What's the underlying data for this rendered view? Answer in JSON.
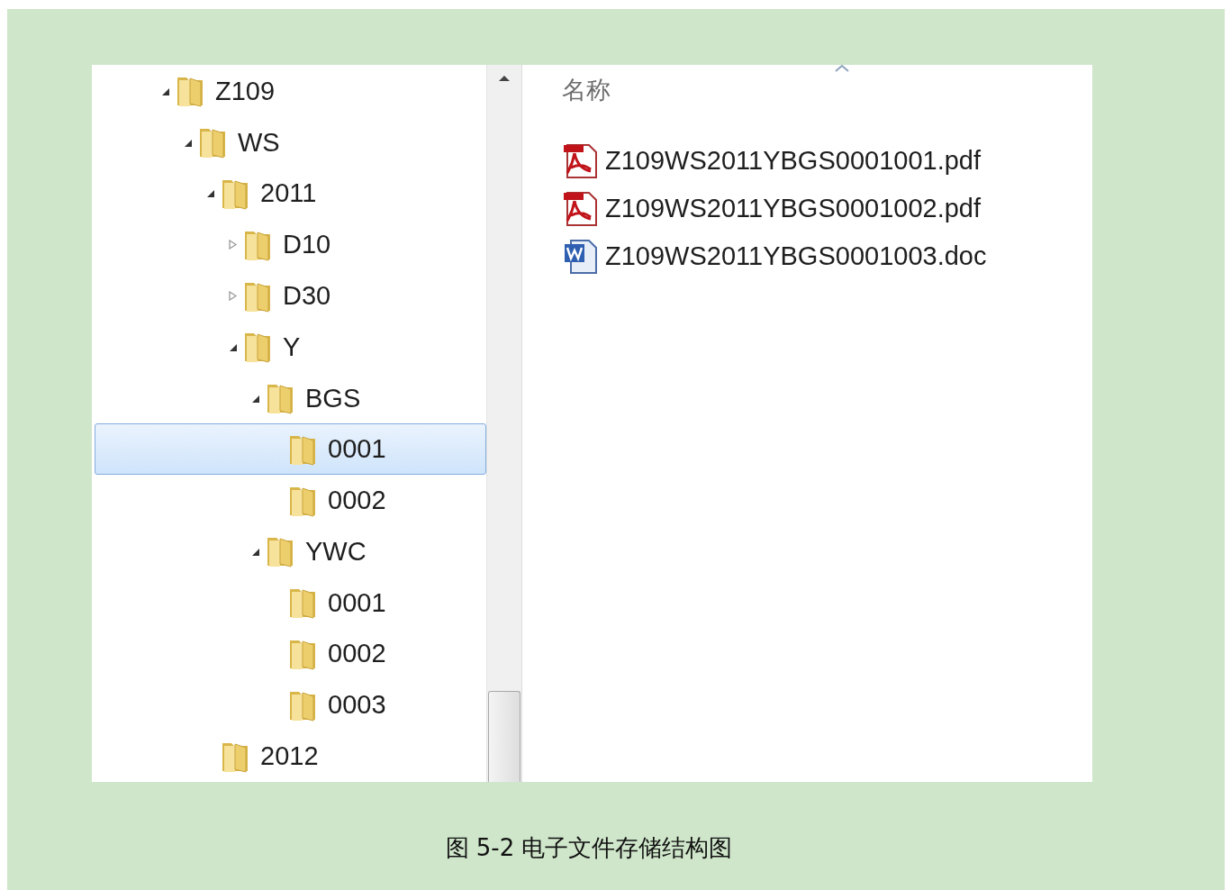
{
  "explorer": {
    "tree": [
      {
        "label": "Z109",
        "expanded": true,
        "selected": false,
        "children": [
          {
            "label": "WS",
            "expanded": true,
            "selected": false,
            "children": [
              {
                "label": "2011",
                "expanded": true,
                "selected": false,
                "children": [
                  {
                    "label": "D10",
                    "expanded": false,
                    "selected": false
                  },
                  {
                    "label": "D30",
                    "expanded": false,
                    "selected": false
                  },
                  {
                    "label": "Y",
                    "expanded": true,
                    "selected": false,
                    "children": [
                      {
                        "label": "BGS",
                        "expanded": true,
                        "selected": false,
                        "children": [
                          {
                            "label": "0001",
                            "selected": true
                          },
                          {
                            "label": "0002",
                            "selected": false
                          }
                        ]
                      },
                      {
                        "label": "YWC",
                        "expanded": true,
                        "selected": false,
                        "children": [
                          {
                            "label": "0001",
                            "selected": false
                          },
                          {
                            "label": "0002",
                            "selected": false
                          },
                          {
                            "label": "0003",
                            "selected": false
                          }
                        ]
                      }
                    ]
                  }
                ]
              },
              {
                "label": "2012",
                "selected": false
              }
            ]
          }
        ]
      }
    ],
    "column_header": "名称",
    "files": [
      {
        "name": "Z109WS2011YBGS0001001.pdf",
        "kind": "pdf"
      },
      {
        "name": "Z109WS2011YBGS0001002.pdf",
        "kind": "pdf"
      },
      {
        "name": "Z109WS2011YBGS0001003.doc",
        "kind": "doc"
      }
    ]
  },
  "caption": "图 5-2 电子文件存储结构图"
}
